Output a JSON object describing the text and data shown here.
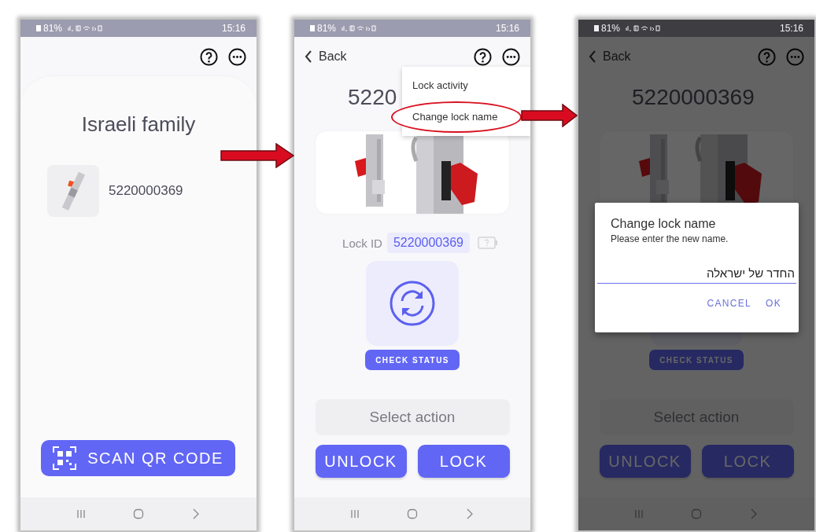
{
  "screens": [
    {
      "kind": "home",
      "status": {
        "battery": "81%",
        "time": "15:16"
      },
      "title": "Israeli family",
      "locks": [
        {
          "name": "5220000369"
        }
      ],
      "scan_button": "SCAN QR CODE"
    },
    {
      "kind": "detail",
      "status": {
        "battery": "81%",
        "time": "15:16"
      },
      "back": "Back",
      "title": "5220",
      "lock_id_label": "Lock ID",
      "lock_id": "5220000369",
      "check_status": "CHECK STATUS",
      "select_action": "Select action",
      "actions": [
        "UNLOCK",
        "LOCK"
      ],
      "menu": {
        "items": [
          {
            "label": "Lock activity",
            "circled": false
          },
          {
            "label": "Change lock name",
            "circled": true
          }
        ]
      }
    },
    {
      "kind": "detail",
      "status": {
        "battery": "81%",
        "time": "15:16"
      },
      "back": "Back",
      "title": "5220000369",
      "check_status": "CHECK STATUS",
      "select_action": "Select action",
      "actions": [
        "UNLOCK",
        "LOCK"
      ],
      "dialog": {
        "title": "Change lock name",
        "message": "Please enter the new name.",
        "value": "החדר של ישראלה",
        "buttons": [
          "CANCEL",
          "OK"
        ]
      }
    }
  ]
}
